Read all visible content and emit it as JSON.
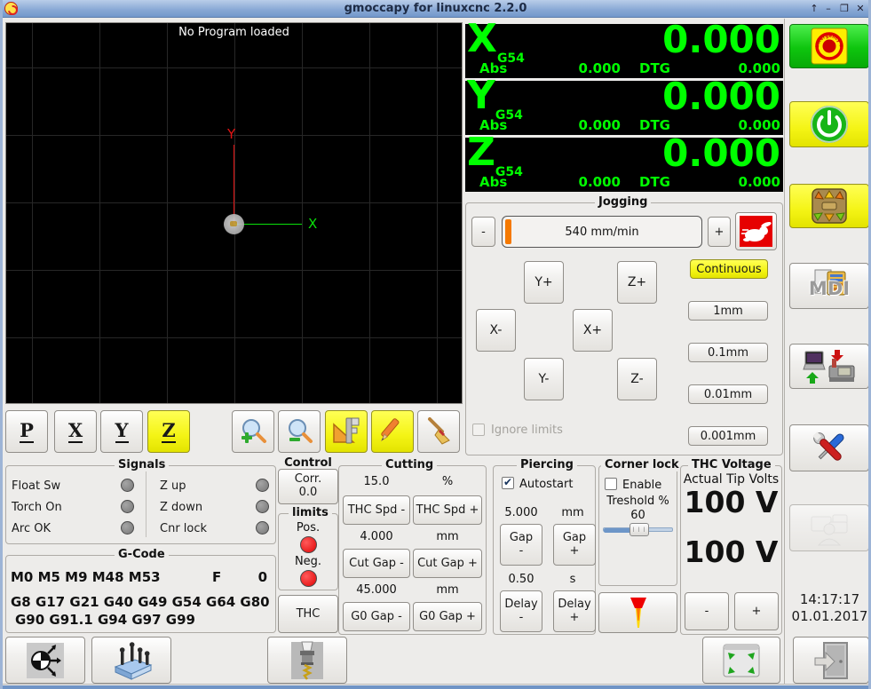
{
  "window": {
    "title": "gmoccapy for linuxcnc  2.2.0",
    "controls": {
      "shade": "↑",
      "minimize": "–",
      "maximize": "❒",
      "close": "✕"
    }
  },
  "preview": {
    "message": "No Program loaded",
    "x_axis_label": "X",
    "y_axis_label": "Y",
    "view_buttons": {
      "p": "P",
      "x": "X",
      "y": "Y",
      "z": "Z"
    }
  },
  "dro": {
    "abs_label": "Abs",
    "dtg_label": "DTG",
    "axes": [
      {
        "letter": "X",
        "system": "G54",
        "value": "0.000",
        "abs": "0.000",
        "dtg": "0.000"
      },
      {
        "letter": "Y",
        "system": "G54",
        "value": "0.000",
        "abs": "0.000",
        "dtg": "0.000"
      },
      {
        "letter": "Z",
        "system": "G54",
        "value": "0.000",
        "abs": "0.000",
        "dtg": "0.000"
      }
    ]
  },
  "jogging": {
    "title": "Jogging",
    "speed_minus": "-",
    "speed_value": "540 mm/min",
    "speed_plus": "+",
    "jog": {
      "yplus": "Y+",
      "zplus": "Z+",
      "xminus": "X-",
      "xplus": "X+",
      "yminus": "Y-",
      "zminus": "Z-"
    },
    "increments": [
      "Continuous",
      "1mm",
      "0.1mm",
      "0.01mm",
      "0.001mm"
    ],
    "ignore_limits_label": "Ignore limits"
  },
  "signals": {
    "title": "Signals",
    "left": [
      {
        "label": "Float Sw"
      },
      {
        "label": "Torch On"
      },
      {
        "label": "Arc OK"
      }
    ],
    "right": [
      {
        "label": "Z up"
      },
      {
        "label": "Z down"
      },
      {
        "label": "Cnr lock"
      }
    ]
  },
  "gcode": {
    "title": "G-Code",
    "mcodes": "M0 M5 M9 M48 M53",
    "f_label": "F",
    "f_value": "0",
    "gcodes_line1": "G8 G17 G21 G40 G49 G54 G64 G80",
    "gcodes_line2": "G90 G91.1 G94 G97 G99"
  },
  "control": {
    "title": "Control",
    "corr_label": "Corr.",
    "corr_value": "0.0",
    "limits_title": "limits",
    "pos_label": "Pos.",
    "neg_label": "Neg.",
    "thc_label": "THC"
  },
  "cutting": {
    "title": "Cutting",
    "rows": [
      {
        "value": "15.0",
        "unit": "%",
        "minus": "THC Spd -",
        "plus": "THC Spd +"
      },
      {
        "value": "4.000",
        "unit": "mm",
        "minus": "Cut Gap -",
        "plus": "Cut Gap +"
      },
      {
        "value": "45.000",
        "unit": "mm",
        "minus": "G0 Gap -",
        "plus": "G0 Gap +"
      }
    ]
  },
  "piercing": {
    "title": "Piercing",
    "autostart_label": "Autostart",
    "gap_value": "5.000",
    "gap_unit": "mm",
    "gap_word": "Gap",
    "delay_value": "0.50",
    "delay_unit": "s",
    "delay_word": "Delay",
    "minus_sign": "-",
    "plus_sign": "+"
  },
  "corner_lock": {
    "title": "Corner lock",
    "enable_label": "Enable",
    "threshold_label": "Treshold %",
    "threshold_value": "60"
  },
  "thc_voltage": {
    "title": "THC Voltage",
    "subtitle": "Actual Tip Volts",
    "actual_volts": "100 V",
    "target_volts": "100 V",
    "minus": "-",
    "plus": "+"
  },
  "sidebar": {
    "mdi_label": "MDI"
  },
  "clock": {
    "time": "14:17:17",
    "date": "01.01.2017"
  },
  "colors": {
    "dro_green": "#00ff00",
    "estop_green": "#0ec50e",
    "active_yellow": "#f4f415",
    "led_red": "#e00404",
    "led_gray": "#8a8a8a",
    "slider_orange": "#f57900"
  }
}
